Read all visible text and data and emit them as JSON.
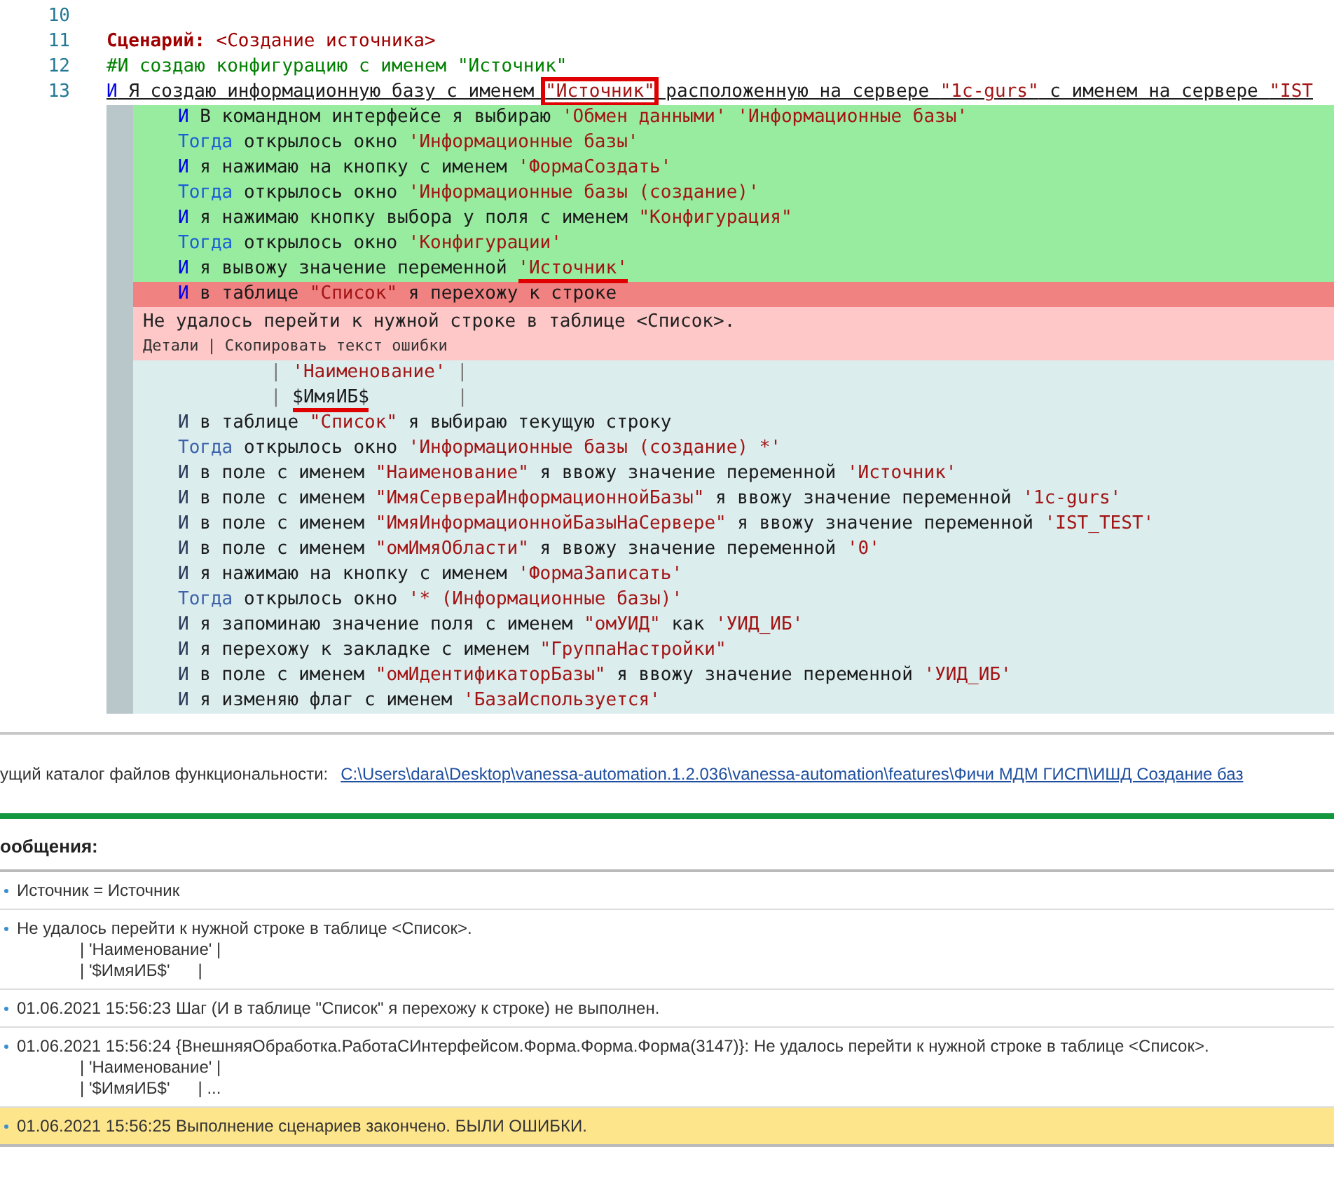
{
  "editor": {
    "lines": [
      {
        "number": "10"
      },
      {
        "number": "11",
        "segments": [
          {
            "kind": "heading",
            "text": "Сценарий:"
          },
          {
            "kind": "title",
            "text": " <Создание источника>"
          }
        ]
      },
      {
        "number": "12",
        "segments": [
          {
            "kind": "comment",
            "text": "#И создаю конфигурацию с именем \"Источник\""
          }
        ]
      },
      {
        "number": "13",
        "underline": true,
        "segments": [
          {
            "kind": "keyword",
            "text": "И"
          },
          {
            "kind": "text",
            "text": " Я создаю информационную базу с именем "
          },
          {
            "kind": "string",
            "text": "\"Источник\"",
            "boxed": true
          },
          {
            "kind": "text",
            "text": " расположенную на сервере "
          },
          {
            "kind": "string",
            "text": "\"1c-gurs\""
          },
          {
            "kind": "text",
            "text": " с именем на сервере "
          },
          {
            "kind": "string",
            "text": "\"IST"
          }
        ]
      }
    ],
    "steps": [
      {
        "kind": "passed",
        "segments": [
          {
            "kind": "keyword",
            "text": "И"
          },
          {
            "kind": "text",
            "text": " В командном интерфейсе я выбираю "
          },
          {
            "kind": "string",
            "text": "'Обмен данными' 'Информационные базы'"
          }
        ]
      },
      {
        "kind": "passed",
        "segments": [
          {
            "kind": "then",
            "text": "Тогда"
          },
          {
            "kind": "text",
            "text": " открылось окно "
          },
          {
            "kind": "string",
            "text": "'Информационные базы'"
          }
        ]
      },
      {
        "kind": "passed",
        "segments": [
          {
            "kind": "keyword",
            "text": "И"
          },
          {
            "kind": "text",
            "text": " я нажимаю на кнопку с именем "
          },
          {
            "kind": "string",
            "text": "'ФормаСоздать'"
          }
        ]
      },
      {
        "kind": "passed",
        "segments": [
          {
            "kind": "then",
            "text": "Тогда"
          },
          {
            "kind": "text",
            "text": " открылось окно "
          },
          {
            "kind": "string",
            "text": "'Информационные базы (создание)'"
          }
        ]
      },
      {
        "kind": "passed",
        "segments": [
          {
            "kind": "keyword",
            "text": "И"
          },
          {
            "kind": "text",
            "text": " я нажимаю кнопку выбора у поля с именем "
          },
          {
            "kind": "string",
            "text": "\"Конфигурация\""
          }
        ]
      },
      {
        "kind": "passed",
        "segments": [
          {
            "kind": "then",
            "text": "Тогда"
          },
          {
            "kind": "text",
            "text": " открылось окно "
          },
          {
            "kind": "string",
            "text": "'Конфигурации'"
          }
        ]
      },
      {
        "kind": "passed",
        "segments": [
          {
            "kind": "keyword",
            "text": "И"
          },
          {
            "kind": "text",
            "text": " я вывожу значение переменной "
          },
          {
            "kind": "string",
            "text": "'Источник'",
            "underlined": true
          }
        ]
      },
      {
        "kind": "failed",
        "segments": [
          {
            "kind": "keyword",
            "text": "И"
          },
          {
            "kind": "text",
            "text": " в таблице "
          },
          {
            "kind": "string",
            "text": "\"Список\""
          },
          {
            "kind": "text",
            "text": " я перехожу к строке"
          }
        ]
      },
      {
        "kind": "error",
        "message": "Не удалось перейти к нужной строке в таблице <Список>.",
        "links": [
          "Детали",
          "Скопировать текст ошибки"
        ],
        "separator": "|"
      },
      {
        "kind": "table_row",
        "segments": [
          {
            "kind": "pipe",
            "text": "| "
          },
          {
            "kind": "string",
            "text": "'Наименование'"
          },
          {
            "kind": "pipe",
            "text": " |"
          }
        ]
      },
      {
        "kind": "table_row",
        "segments": [
          {
            "kind": "pipe",
            "text": "| "
          },
          {
            "kind": "text",
            "text": "$ИмяИБ$",
            "underlined": true
          },
          {
            "kind": "pipe",
            "text": "        |"
          }
        ]
      },
      {
        "kind": "pending",
        "segments": [
          {
            "kind": "keyword",
            "text": "И"
          },
          {
            "kind": "text",
            "text": " в таблице "
          },
          {
            "kind": "string",
            "text": "\"Список\""
          },
          {
            "kind": "text",
            "text": " я выбираю текущую строку"
          }
        ]
      },
      {
        "kind": "pending",
        "segments": [
          {
            "kind": "then",
            "text": "Тогда"
          },
          {
            "kind": "text",
            "text": " открылось окно "
          },
          {
            "kind": "string",
            "text": "'Информационные базы (создание) *'"
          }
        ]
      },
      {
        "kind": "pending",
        "segments": [
          {
            "kind": "keyword",
            "text": "И"
          },
          {
            "kind": "text",
            "text": " в поле с именем "
          },
          {
            "kind": "string",
            "text": "\"Наименование\""
          },
          {
            "kind": "text",
            "text": " я ввожу значение переменной "
          },
          {
            "kind": "string",
            "text": "'Источник'"
          }
        ]
      },
      {
        "kind": "pending",
        "segments": [
          {
            "kind": "keyword",
            "text": "И"
          },
          {
            "kind": "text",
            "text": " в поле с именем "
          },
          {
            "kind": "string",
            "text": "\"ИмяСервераИнформационнойБазы\""
          },
          {
            "kind": "text",
            "text": " я ввожу значение переменной "
          },
          {
            "kind": "string",
            "text": "'1c-gurs'"
          }
        ]
      },
      {
        "kind": "pending",
        "segments": [
          {
            "kind": "keyword",
            "text": "И"
          },
          {
            "kind": "text",
            "text": " в поле с именем "
          },
          {
            "kind": "string",
            "text": "\"ИмяИнформационнойБазыНаСервере\""
          },
          {
            "kind": "text",
            "text": " я ввожу значение переменной "
          },
          {
            "kind": "string",
            "text": "'IST_TEST'"
          }
        ]
      },
      {
        "kind": "pending",
        "segments": [
          {
            "kind": "keyword",
            "text": "И"
          },
          {
            "kind": "text",
            "text": " в поле с именем "
          },
          {
            "kind": "string",
            "text": "\"омИмяОбласти\""
          },
          {
            "kind": "text",
            "text": " я ввожу значение переменной "
          },
          {
            "kind": "string",
            "text": "'0'"
          }
        ]
      },
      {
        "kind": "pending",
        "segments": [
          {
            "kind": "keyword",
            "text": "И"
          },
          {
            "kind": "text",
            "text": " я нажимаю на кнопку с именем "
          },
          {
            "kind": "string",
            "text": "'ФормаЗаписать'"
          }
        ]
      },
      {
        "kind": "pending",
        "segments": [
          {
            "kind": "then",
            "text": "Тогда"
          },
          {
            "kind": "text",
            "text": " открылось окно "
          },
          {
            "kind": "string",
            "text": "'* (Информационные базы)'"
          }
        ]
      },
      {
        "kind": "pending",
        "segments": [
          {
            "kind": "keyword",
            "text": "И"
          },
          {
            "kind": "text",
            "text": " я запоминаю значение поля с именем "
          },
          {
            "kind": "string",
            "text": "\"омУИД\""
          },
          {
            "kind": "text",
            "text": " как "
          },
          {
            "kind": "string",
            "text": "'УИД_ИБ'"
          }
        ]
      },
      {
        "kind": "pending",
        "segments": [
          {
            "kind": "keyword",
            "text": "И"
          },
          {
            "kind": "text",
            "text": " я перехожу к закладке с именем "
          },
          {
            "kind": "string",
            "text": "\"ГруппаНастройки\""
          }
        ]
      },
      {
        "kind": "pending",
        "segments": [
          {
            "kind": "keyword",
            "text": "И"
          },
          {
            "kind": "text",
            "text": " в поле с именем "
          },
          {
            "kind": "string",
            "text": "\"омИдентификаторБазы\""
          },
          {
            "kind": "text",
            "text": " я ввожу значение переменной "
          },
          {
            "kind": "string",
            "text": "'УИД_ИБ'"
          }
        ]
      },
      {
        "kind": "pending",
        "segments": [
          {
            "kind": "keyword",
            "text": "И"
          },
          {
            "kind": "text",
            "text": " я изменяю флаг с именем "
          },
          {
            "kind": "string",
            "text": "'БазаИспользуется'"
          }
        ]
      }
    ]
  },
  "path": {
    "label": "ущий каталог файлов функциональности:",
    "link": "C:\\Users\\dara\\Desktop\\vanessa-automation.1.2.036\\vanessa-automation\\features\\Фичи МДМ ГИСП\\ИШД Создание баз"
  },
  "messages": {
    "title": "ообщения:",
    "items": [
      {
        "highlighted": false,
        "lines": [
          "Источник = Источник"
        ]
      },
      {
        "highlighted": false,
        "lines": [
          "Не удалось перейти к нужной строке в таблице <Список>.",
          "| 'Наименование' |",
          "| '$ИмяИБ$'      |"
        ]
      },
      {
        "highlighted": false,
        "lines": [
          "01.06.2021 15:56:23 Шаг (И в таблице \"Список\" я перехожу к строке) не выполнен."
        ]
      },
      {
        "highlighted": false,
        "lines": [
          "01.06.2021 15:56:24 {ВнешняяОбработка.РаботаСИнтерфейсом.Форма.Форма.Форма(3147)}: Не удалось перейти к нужной строке в таблице <Список>.",
          "| 'Наименование' |",
          "| '$ИмяИБ$'      | ..."
        ]
      },
      {
        "highlighted": true,
        "lines": [
          "01.06.2021 15:56:25 Выполнение сценариев закончено. БЫЛИ ОШИБКИ."
        ]
      }
    ]
  }
}
